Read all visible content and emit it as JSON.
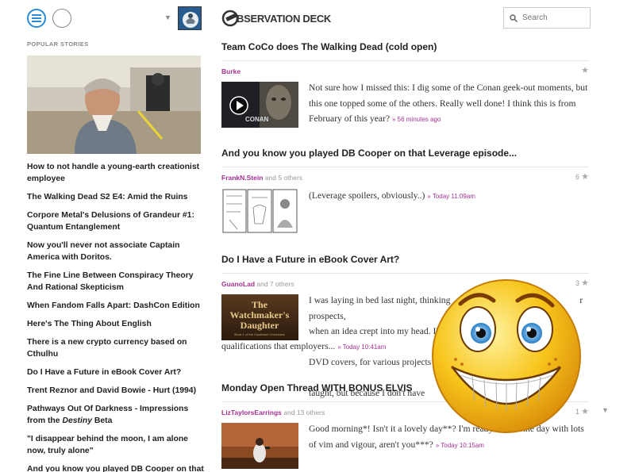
{
  "sidebar": {
    "popular_label": "POPULAR STORIES",
    "stories": [
      "How to not handle a young-earth creationist employee",
      "The Walking Dead S2 E4: Amid the Ruins",
      "Corpore Metal's Delusions of Grandeur #1: Quantum Entanglement",
      "Now you'll never not associate Captain America with Doritos.",
      "The Fine Line Between Conspiracy Theory And Rational Skepticism",
      "When Fandom Falls Apart: DashCon Edition",
      "Here's The Thing About English",
      "There is a new crypto currency based on Cthulhu",
      "Do I Have a Future in eBook Cover Art?",
      "Trent Reznor and David Bowie - Hurt (1994)",
      "\"I disappear behind the moon, I am alone now, truly alone\"",
      "And you know you played DB Cooper on that Leverage episode..."
    ],
    "story_pathways_prefix": "Pathways Out Of Darkness - Impressions from the ",
    "story_pathways_italic": "Destiny",
    "story_pathways_suffix": " Beta",
    "icons": {
      "menu": "hamburger-icon",
      "user": "user-icon",
      "caret": "caret-down-icon"
    }
  },
  "header": {
    "logo_text": "BSERVATION DECK",
    "search_placeholder": "Search"
  },
  "posts": [
    {
      "title": "Team CoCo does The Walking Dead (cold open)",
      "author": "Burke",
      "others": "",
      "count": "",
      "text": "Not sure how I missed this: I dig some of the Conan geek-out moments, but this one topped some of the others. Really well done! I think this is from February of this year?",
      "time": "» 56 minutes ago"
    },
    {
      "title": "And you know you played DB Cooper on that Leverage episode...",
      "author": "FrankN.Stein",
      "others": "and 5 others",
      "count": "6",
      "text": "(Leverage spoilers, obviously..)",
      "time": "» Today 11:09am"
    },
    {
      "title": "Do I Have a Future in eBook Cover Art?",
      "author": "GuanoLad",
      "others": "and 7 others",
      "count": "3",
      "text_line1": "I was laying in bed last night, thinking",
      "text_line1b": "r prospects,",
      "text_line2": "when an idea crept into my head. I'",
      "text_line2b": "ebsites,",
      "text_line3": "DVD covers, for various projects f",
      "text_line3b": "self-",
      "text_line4": "taught, but because I don't have",
      "text_line5": "qualifications that employers...",
      "time": "» Today 10:41am",
      "cover_title": "The Watchmaker's Daughter",
      "cover_subtitle": "Book 1 of the Clockwork Chronicles"
    },
    {
      "title": "Monday Open Thread WITH BONUS ELVIS",
      "author": "LizTaylorsEarrings",
      "others": "and 13 others",
      "count": "1",
      "text": "Good morning*! Isn't it a lovely day**? I'm ready to start the day with lots of vim and vigour, aren't you***?",
      "time": "» Today 10:15am"
    }
  ],
  "thumb_overlay": {
    "conan_text": "CONAN"
  },
  "colors": {
    "accent": "#a43296",
    "menu_blue": "#2a8bd6",
    "emoji_yellow": "#f7c51b"
  }
}
